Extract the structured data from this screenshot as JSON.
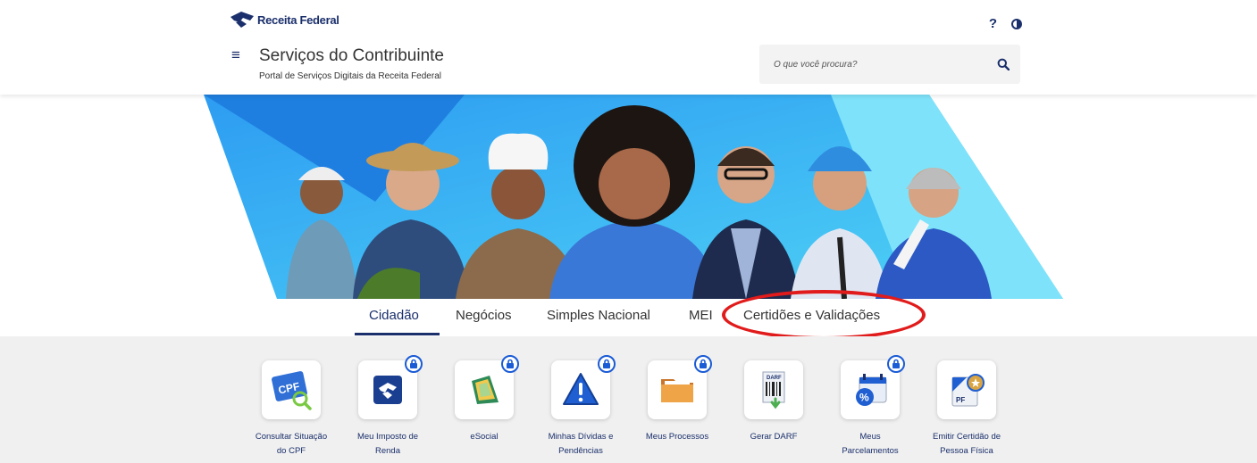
{
  "header": {
    "logo_text": "Receita Federal",
    "help_label": "?",
    "menu_glyph": "≡",
    "app_title": "Serviços do Contribuinte",
    "app_subtitle": "Portal de Serviços Digitais da Receita Federal",
    "search_placeholder": "O que você procura?",
    "icons": [
      "menu-icon",
      "help-icon",
      "contrast-icon",
      "search-icon"
    ]
  },
  "tabs": [
    {
      "label": "Cidadão",
      "active": true
    },
    {
      "label": "Negócios",
      "active": false
    },
    {
      "label": "Simples Nacional",
      "active": false
    },
    {
      "label": "MEI",
      "active": false
    },
    {
      "label": "Certidões e Validações",
      "active": false
    }
  ],
  "services": [
    {
      "label_line1": "Consultar Situação",
      "label_line2": "do CPF",
      "icon": "cpf-card-icon",
      "locked": false
    },
    {
      "label_line1": "Meu Imposto de",
      "label_line2": "Renda",
      "icon": "receita-logo-icon",
      "locked": true
    },
    {
      "label_line1": "eSocial",
      "label_line2": "",
      "icon": "esocial-icon",
      "locked": true
    },
    {
      "label_line1": "Minhas Dívidas e",
      "label_line2": "Pendências",
      "icon": "warning-icon",
      "locked": true
    },
    {
      "label_line1": "Meus Processos",
      "label_line2": "",
      "icon": "folder-icon",
      "locked": true
    },
    {
      "label_line1": "Gerar DARF",
      "label_line2": "",
      "icon": "darf-barcode-icon",
      "locked": false
    },
    {
      "label_line1": "Meus",
      "label_line2": "Parcelamentos",
      "icon": "calendar-percent-icon",
      "locked": true
    },
    {
      "label_line1": "Emitir Certidão de",
      "label_line2": "Pessoa Física",
      "icon": "certificate-icon",
      "locked": false
    }
  ],
  "icon_text": {
    "cpf": "CPF",
    "darf": "DARF",
    "percent": "%",
    "pf": "PF"
  },
  "colors": {
    "brand_navy": "#1a2f6b",
    "banner_blue": "#34b4f0",
    "lock_blue": "#1a5bd6",
    "annotation_red": "#e11b1b"
  }
}
